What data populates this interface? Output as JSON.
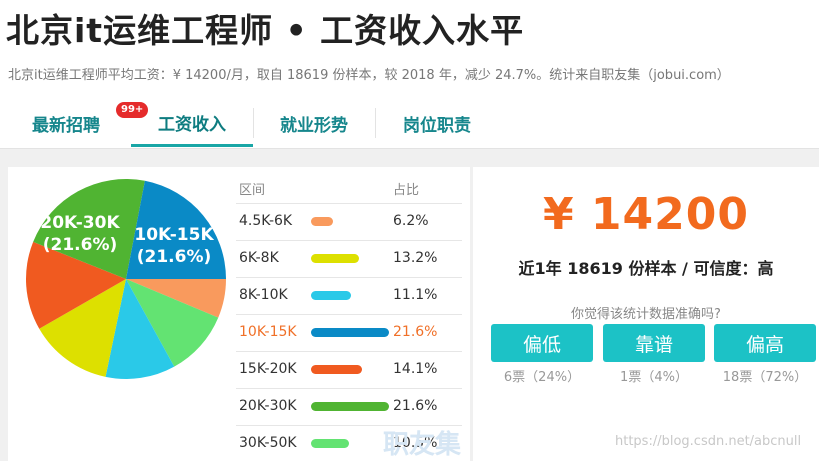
{
  "page": {
    "title": "北京it运维工程师 • 工资收入水平",
    "subtitle": "北京it运维工程师平均工资：¥ 14200/月，取自 18619 份样本，较 2018 年，减少 24.7%。统计来自职友集（jobui.com）"
  },
  "tabs": [
    {
      "label": "最新招聘",
      "badge": "99+"
    },
    {
      "label": "工资收入"
    },
    {
      "label": "就业形势"
    },
    {
      "label": "岗位职责"
    }
  ],
  "table": {
    "headers": {
      "range": "区间",
      "pct": "占比"
    },
    "rows": [
      {
        "range": "4.5K-6K",
        "pct": "6.2%",
        "value": 6.2,
        "color": "#f99a5d"
      },
      {
        "range": "6K-8K",
        "pct": "13.2%",
        "value": 13.2,
        "color": "#dde000"
      },
      {
        "range": "8K-10K",
        "pct": "11.1%",
        "value": 11.1,
        "color": "#2ac9e8"
      },
      {
        "range": "10K-15K",
        "pct": "21.6%",
        "value": 21.6,
        "color": "#0a8ac6",
        "highlight": true
      },
      {
        "range": "15K-20K",
        "pct": "14.1%",
        "value": 14.1,
        "color": "#f05a20"
      },
      {
        "range": "20K-30K",
        "pct": "21.6%",
        "value": 21.6,
        "color": "#50b432"
      },
      {
        "range": "30K-50K",
        "pct": "10.5%",
        "value": 10.5,
        "color": "#63e372"
      }
    ]
  },
  "pie": {
    "labels": [
      {
        "range": "10K-15K",
        "pct": "(21.6%)"
      },
      {
        "range": "20K-30K",
        "pct": "(21.6%)"
      }
    ]
  },
  "stats": {
    "salary": "¥ 14200",
    "sample_text": "近1年 18619 份样本 / 可信度：高",
    "question": "你觉得该统计数据准确吗?"
  },
  "votes": [
    {
      "label": "偏低",
      "count": "6票（24%）"
    },
    {
      "label": "靠谱",
      "count": "1票（4%）"
    },
    {
      "label": "偏高",
      "count": "18票（72%）"
    }
  ],
  "watermarks": {
    "site": "职友集",
    "url": "https://blog.csdn.net/abcnull"
  }
}
